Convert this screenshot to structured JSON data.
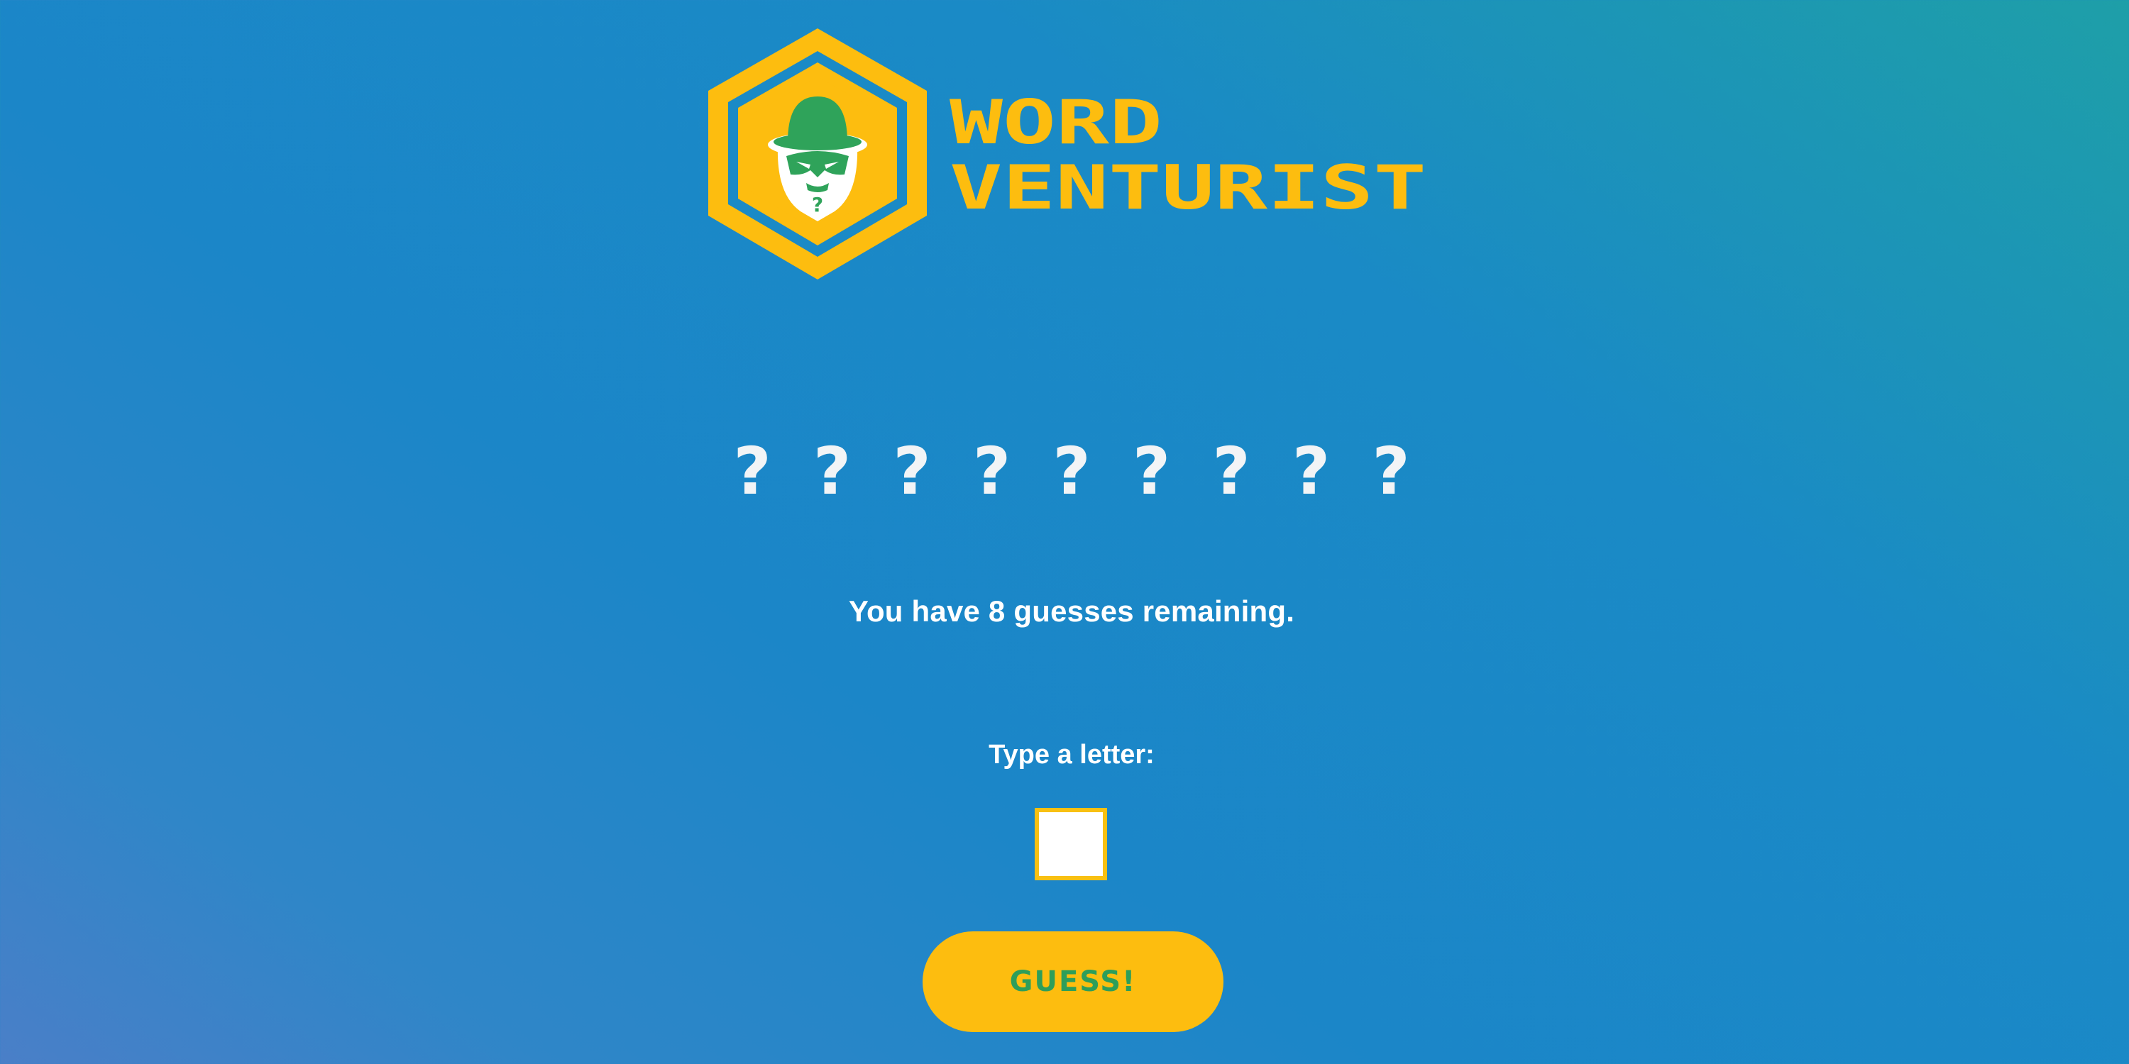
{
  "logo": {
    "line1": "WORD",
    "line2": "VENTURIST",
    "mascot_mark": "?",
    "mascot_icon": "masked-character-in-bowler-hat-icon"
  },
  "word": {
    "slots": [
      "?",
      "?",
      "?",
      "?",
      "?",
      "?",
      "?",
      "?",
      "?"
    ]
  },
  "status": {
    "guesses_text": "You have 8 guesses remaining."
  },
  "input": {
    "prompt": "Type a letter:",
    "value": ""
  },
  "button": {
    "label": "GUESS!"
  },
  "colors": {
    "brand_yellow": "#fdbd0f",
    "mascot_green": "#2fa35a",
    "text_white": "#ffffff"
  }
}
